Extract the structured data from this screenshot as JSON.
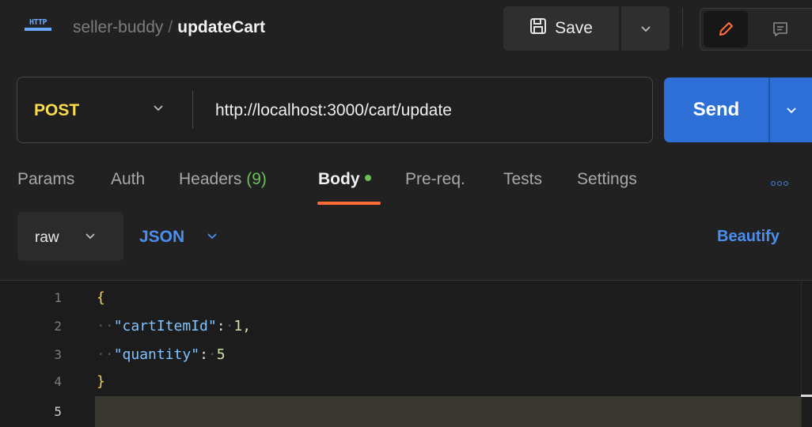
{
  "header": {
    "protocol_icon": "HTTP",
    "collection": "seller-buddy",
    "separator": "/",
    "request_name": "updateCart",
    "save_label": "Save",
    "icons": [
      "http-icon",
      "save-icon",
      "chevron-down-icon",
      "pencil-icon",
      "comment-icon"
    ]
  },
  "request": {
    "method": "POST",
    "url": "http://localhost:3000/cart/update",
    "send_label": "Send"
  },
  "tabs": [
    {
      "label": "Params"
    },
    {
      "label": "Auth"
    },
    {
      "label": "Headers",
      "count": "(9)"
    },
    {
      "label": "Body",
      "active": true
    },
    {
      "label": "Pre-req."
    },
    {
      "label": "Tests"
    },
    {
      "label": "Settings"
    }
  ],
  "body_options": {
    "mode": "raw",
    "language": "JSON",
    "beautify_label": "Beautify"
  },
  "editor": {
    "lines": [
      {
        "num": "1",
        "text": "{"
      },
      {
        "num": "2",
        "key": "\"cartItemId\"",
        "value": "1,"
      },
      {
        "num": "3",
        "key": "\"quantity\"",
        "value": "5"
      },
      {
        "num": "4",
        "text": "}"
      },
      {
        "num": "5",
        "text": ""
      }
    ]
  },
  "colors": {
    "method": "#fddc4c",
    "send": "#2d6fd6",
    "active_tab_underline": "#ff6c37",
    "accent": "#4c8ef0",
    "body_dot": "#6bbf59"
  }
}
